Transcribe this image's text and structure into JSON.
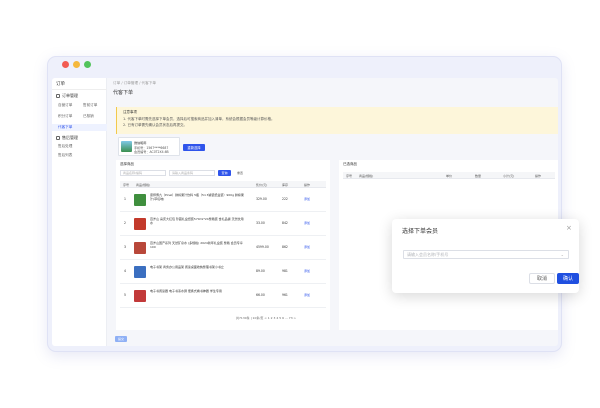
{
  "sidebar": {
    "title": "订单",
    "groups": [
      {
        "label": "订单管理",
        "items": [
          "自营订单",
          "售前订单",
          "积分订单",
          "已核销",
          "代客下单"
        ]
      },
      {
        "label": "售后管理",
        "items": [
          "售后处理",
          "售后列表"
        ]
      }
    ]
  },
  "breadcrumb": "订单 / 订单管理 / 代客下单",
  "page_title": "代客下单",
  "notice": {
    "title": "注意事项",
    "lines": [
      "1. 代客下单时需先选择下单会员，选择后可搜索商品并加入清单，系统会根据会员等级计算价格。",
      "2. 已有订单需先确认会员状态后再提交。"
    ]
  },
  "member": {
    "name": "微信昵称",
    "phone_line": "手机号：1567****6687",
    "level_line": "可用积分：无",
    "id_line": "会员编号：AC0T2X4.6B",
    "select_button": "重新选择"
  },
  "left_panel": {
    "title": "选择商品",
    "search_placeholder": "商品名称/编码",
    "search_placeholder2": "请输入商品条码",
    "query_button": "查询",
    "reset_button": "重置",
    "columns": [
      "序号",
      "商品(规格)",
      "售价(元)",
      "库存",
      "操作"
    ],
    "rows": [
      {
        "no": "1",
        "name": "康师傅九（Pinel）鲜榨果汁饮料 5瓶（5×3罐装纸盒装）900g 鲜榨果汁(草莓味)",
        "price": "329.00",
        "stock": "222",
        "action": "添加",
        "color": "#3f8f3e"
      },
      {
        "no": "2",
        "name": "百岁山 喜庆大红包 珍藏礼盒纸装570ml*24整箱装 含礼品袋 天然饮用水",
        "price": "33.00",
        "stock": "842",
        "action": "添加",
        "color": "#c33a2b"
      },
      {
        "no": "3",
        "name": "百岁山国产系列 天然矿泉水 (多规格) 2024新年礼盒装 整箱 会员专享 100",
        "price": "4599.00",
        "stock": "862",
        "action": "添加",
        "color": "#b8473a"
      },
      {
        "no": "4",
        "name": "电子书架 商务办公用品架 阅读桌面收纳整理书架小书立",
        "price": "89.00",
        "stock": "981",
        "action": "添加",
        "color": "#3b6fc0"
      },
      {
        "no": "5",
        "name": "电子书阅读器 电子书墨水屏 便携式看书神器 学生专用",
        "price": "66.00",
        "stock": "961",
        "action": "添加",
        "color": "#c23a3a"
      }
    ],
    "pager": "共7130条 | 10条/页  <  1  2  3  4  5  6  ...  73  >"
  },
  "right_panel": {
    "title": "已选商品",
    "columns": [
      "序号",
      "商品(规格)",
      "单价",
      "数量",
      "小计(元)",
      "操作"
    ]
  },
  "submit_button": "提交",
  "modal": {
    "title": "选择下单会员",
    "placeholder": "请输入会员名称/手机号",
    "cancel": "取消",
    "ok": "确认"
  }
}
